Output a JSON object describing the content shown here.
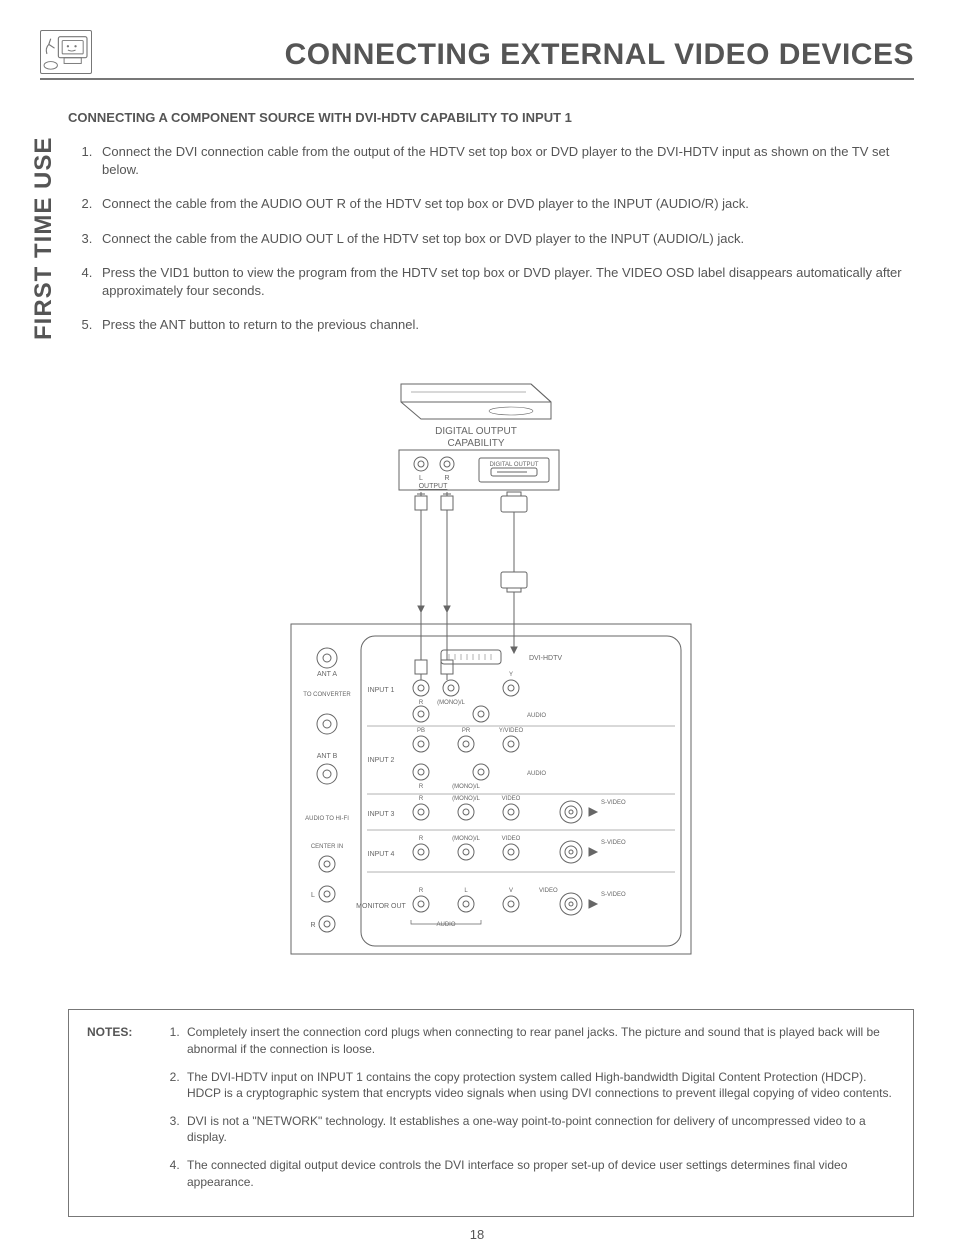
{
  "header": {
    "title": "CONNECTING EXTERNAL VIDEO DEVICES"
  },
  "side_label": "FIRST TIME USE",
  "sub_heading": "CONNECTING A COMPONENT SOURCE WITH DVI-HDTV CAPABILITY TO INPUT 1",
  "steps": [
    "Connect the DVI connection cable from the output of the HDTV set top box or DVD player to the DVI-HDTV input as shown on the TV set below.",
    "Connect the cable from the AUDIO OUT R of the HDTV set top box or DVD player to the INPUT (AUDIO/R) jack.",
    "Connect the cable from the AUDIO OUT L of the HDTV set top box or DVD player to the INPUT (AUDIO/L) jack.",
    "Press the VID1 button to view the program from the HDTV set top box or DVD player.  The VIDEO OSD label disappears automatically after approximately four seconds.",
    "Press the ANT button to return to the previous channel."
  ],
  "diagram": {
    "top_device_line1": "DIGITAL OUTPUT",
    "top_device_line2": "CAPABILITY",
    "top_L": "L",
    "top_R": "R",
    "top_output": "OUTPUT",
    "digital_output_box": "DIGITAL OUTPUT",
    "dvi_hdtv": "DVI-HDTV",
    "ant_a": "ANT A",
    "to_converter": "TO CONVERTER",
    "ant_b": "ANT B",
    "input1": "INPUT 1",
    "input2": "INPUT 2",
    "input3": "INPUT 3",
    "input4": "INPUT 4",
    "monitor_out": "MONITOR OUT",
    "audio_to_hifi": "AUDIO TO HI-FI",
    "center_in": "CENTER IN",
    "y": "Y",
    "r": "R",
    "l": "L",
    "mono_l": "(MONO)/L",
    "audio": "AUDIO",
    "pb": "PB",
    "pr": "PR",
    "y_video": "Y/VIDEO",
    "video": "VIDEO",
    "s_video": "S-VIDEO",
    "v": "V",
    "audio_label": "AUDIO"
  },
  "notes": {
    "label": "NOTES:",
    "items": [
      "Completely insert the connection cord plugs when connecting to rear panel jacks.  The picture and sound that is played back will be abnormal if the connection is loose.",
      "The DVI-HDTV input on INPUT 1 contains the copy protection system called High-bandwidth Digital Content Protection (HDCP).  HDCP is a cryptographic system that encrypts video signals when using DVI connections to prevent illegal copying of video contents.",
      "DVI is not a \"NETWORK\" technology.  It establishes a one-way point-to-point connection for delivery of uncompressed video to a display.",
      "The connected digital output device controls the DVI interface so proper set-up of device user settings determines final video appearance."
    ]
  },
  "page_number": "18"
}
